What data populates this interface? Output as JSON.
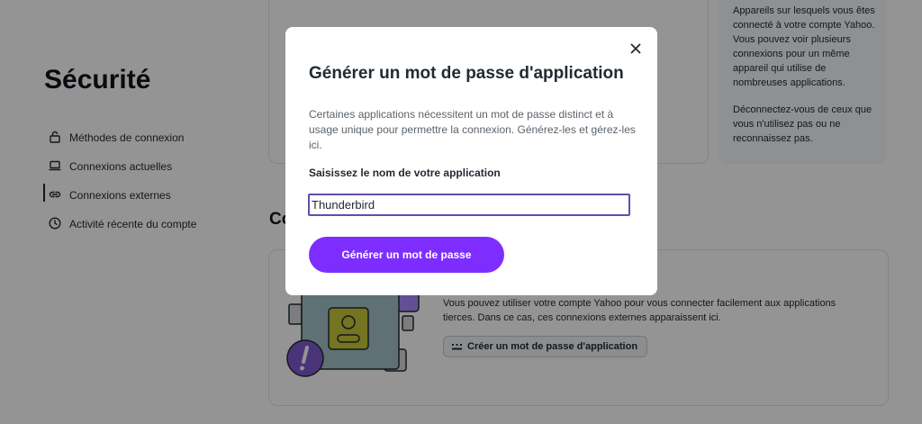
{
  "page_title": "Sécurité",
  "nav": {
    "items": [
      {
        "label": "Méthodes de connexion",
        "icon": "lock-icon"
      },
      {
        "label": "Connexions actuelles",
        "icon": "laptop-icon"
      },
      {
        "label": "Connexions externes",
        "icon": "link-icon",
        "active": true
      },
      {
        "label": "Activité récente du compte",
        "icon": "clock-icon"
      }
    ]
  },
  "info_card": {
    "paragraph1": "Appareils sur lesquels vous êtes connecté à votre compte Yahoo. Vous pouvez voir plusieurs connexions pour un même appareil qui utilise de nombreuses applications.",
    "paragraph2": "Déconnectez-vous de ceux que vous n'utilisez pas ou ne reconnaissez pas."
  },
  "section_heading": "Co",
  "external_card": {
    "description": "Vous pouvez utiliser votre compte Yahoo pour vous connecter facilement aux applications tierces. Dans ce cas, ces connexions externes apparaissent ici.",
    "create_button_label": "Créer un mot de passe d'application"
  },
  "modal": {
    "title": "Générer un mot de passe d'application",
    "description": "Certaines applications nécessitent un mot de passe distinct et à usage unique pour permettre la connexion. Générez-les et gérez-les ici.",
    "field_label": "Saisissez le nom de votre application",
    "input_value": "Thunderbird",
    "generate_button_label": "Générer un mot de passe"
  },
  "colors": {
    "accent": "#7d2eff",
    "input_border": "#5f4fa8",
    "overlay": "rgba(0,0,0,0.42)"
  }
}
